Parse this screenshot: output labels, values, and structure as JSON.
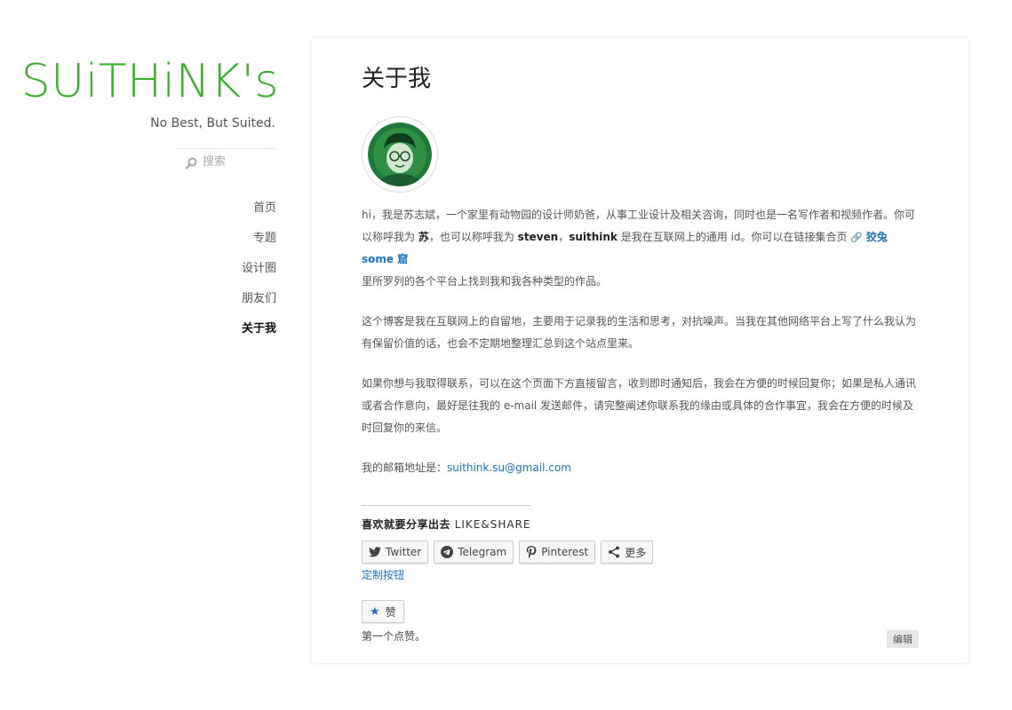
{
  "site": {
    "title": "SUiTHiNK's",
    "tagline": "No Best, But Suited.",
    "brand_color": "#3ab02d"
  },
  "search": {
    "placeholder": "搜索",
    "icon": "search-icon"
  },
  "nav": {
    "items": [
      {
        "label": "首页"
      },
      {
        "label": "专题"
      },
      {
        "label": "设计圈"
      },
      {
        "label": "朋友们"
      },
      {
        "label": "关于我",
        "active": true
      }
    ]
  },
  "page": {
    "title": "关于我",
    "p1": {
      "a": "hi，我是苏志斌，一个家里有动物园的设计师奶爸，从事工业设计及相关咨询，同时也是一名写作者和视频作者。你可以称呼我为 ",
      "b_su": "苏",
      "c": "，也可以称呼我为 ",
      "b_steven": "steven",
      "d": "，",
      "b_suithink": "suithink",
      "e": " 是我在互联网上的通用 id。你可以在链接集合页 ",
      "link_glyph": "🔗",
      "link_text": "狡兔 some 窟",
      "f": "里所罗列的各个平台上找到我和我各种类型的作品。"
    },
    "p2": "这个博客是我在互联网上的自留地，主要用于记录我的生活和思考，对抗噪声。当我在其他网络平台上写了什么我认为有保留价值的话，也会不定期地整理汇总到这个站点里来。",
    "p3": "如果你想与我取得联系，可以在这个页面下方直接留言，收到即时通知后，我会在方便的时候回复你；如果是私人通讯或者合作意向，最好是往我的 e-mail 发送邮件，请完整阐述你联系我的缘由或具体的合作事宜，我会在方便的时候及时回复你的来信。",
    "email_label": "我的邮箱地址是：",
    "email": "suithink.su@gmail.com",
    "link_color": "#1e73be"
  },
  "share": {
    "heading_cn": "喜欢就要分享出去",
    "heading_en": "LIKE&SHARE",
    "buttons": [
      {
        "label": "Twitter",
        "icon": "twitter-icon"
      },
      {
        "label": "Telegram",
        "icon": "telegram-icon"
      },
      {
        "label": "Pinterest",
        "icon": "pinterest-icon"
      },
      {
        "label": "更多",
        "icon": "share-icon"
      }
    ],
    "custom_link": "定制按钮"
  },
  "like": {
    "label": "赞",
    "icon": "star-icon",
    "note": "第一个点赞。"
  },
  "edit_label": "编辑"
}
